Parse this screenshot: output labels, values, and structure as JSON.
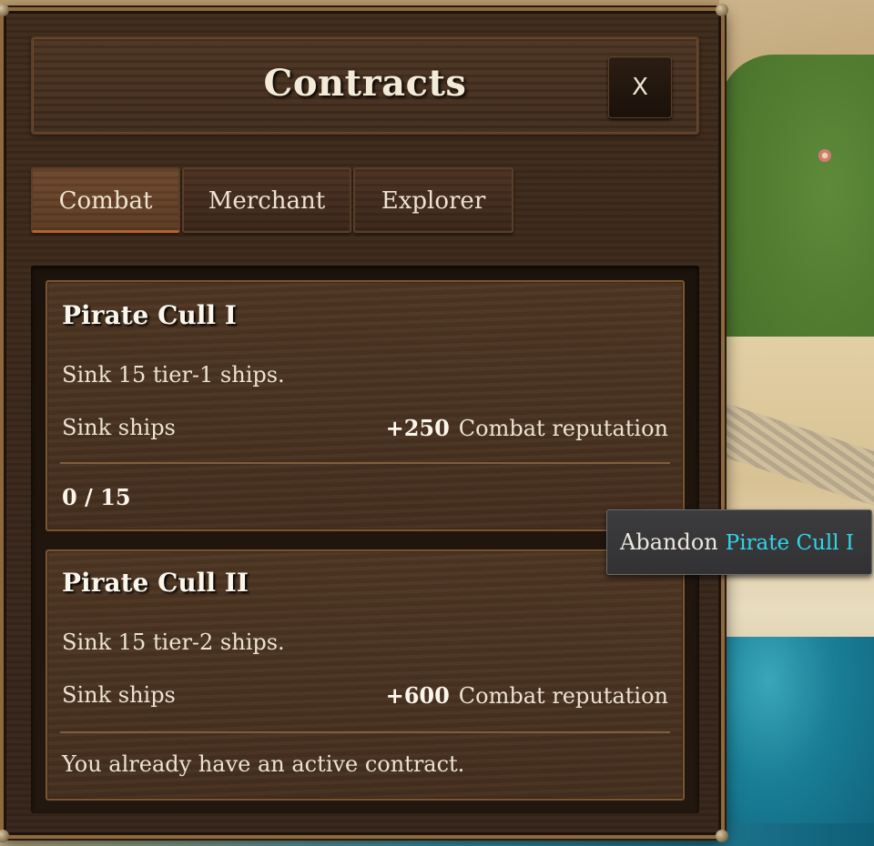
{
  "window": {
    "title": "Contracts",
    "close_label": "X"
  },
  "tabs": [
    {
      "label": "Combat",
      "active": true
    },
    {
      "label": "Merchant",
      "active": false
    },
    {
      "label": "Explorer",
      "active": false
    }
  ],
  "contracts": [
    {
      "title": "Pirate Cull I",
      "description": "Sink 15 tier-1 ships.",
      "objective": "Sink ships",
      "reward_amount": "+250",
      "reward_label": "Combat reputation",
      "status": "0 / 15",
      "progress": {
        "current": 0,
        "total": 15
      }
    },
    {
      "title": "Pirate Cull II",
      "description": "Sink 15 tier-2 ships.",
      "objective": "Sink ships",
      "reward_amount": "+600",
      "reward_label": "Combat reputation",
      "status": "You already have an active contract."
    }
  ],
  "tooltip": {
    "action": "Abandon",
    "target": "Pirate Cull I",
    "target_color": "#2fd6e8"
  },
  "colors": {
    "active_tab_underline": "#b8632c",
    "frame_brass": "#8e6a3a"
  }
}
